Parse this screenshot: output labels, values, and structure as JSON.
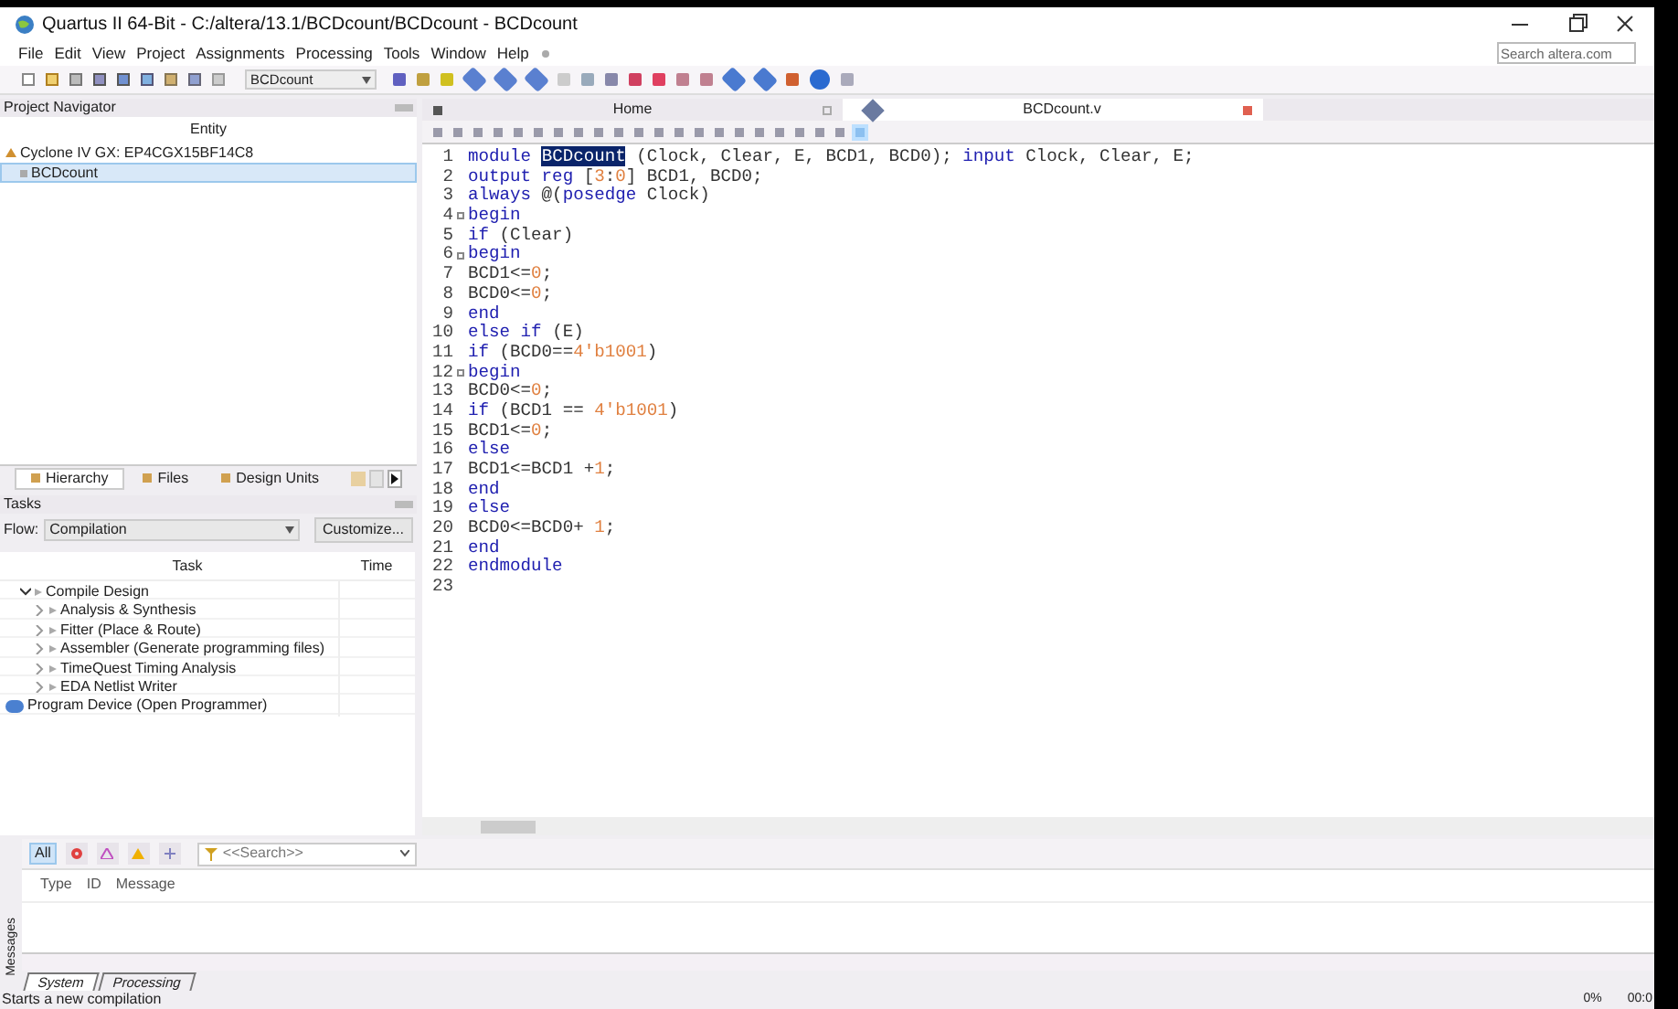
{
  "window": {
    "title": "Quartus II 64-Bit - C:/altera/13.1/BCDcount/BCDcount - BCDcount",
    "search_placeholder": "Search altera.com"
  },
  "menu": [
    "File",
    "Edit",
    "View",
    "Project",
    "Assignments",
    "Processing",
    "Tools",
    "Window",
    "Help"
  ],
  "toolbar": {
    "entity": "BCDcount"
  },
  "project_navigator": {
    "title": "Project Navigator",
    "column": "Entity",
    "tree": [
      {
        "label": "Cyclone IV GX: EP4CGX15BF14C8",
        "selected": false,
        "children": [
          {
            "label": "BCDcount",
            "selected": true
          }
        ]
      }
    ],
    "tabs": [
      {
        "label": "Hierarchy",
        "selected": true
      },
      {
        "label": "Files",
        "selected": false
      },
      {
        "label": "Design Units",
        "selected": false
      }
    ]
  },
  "tasks": {
    "title": "Tasks",
    "flow_label": "Flow:",
    "flow": "Compilation",
    "customize": "Customize...",
    "columns": [
      "Task",
      "Time"
    ],
    "items": [
      {
        "label": "Compile Design",
        "kind": "flow",
        "expanded": true,
        "children": [
          {
            "label": "Analysis & Synthesis",
            "kind": "flow",
            "expanded": false
          },
          {
            "label": "Fitter (Place & Route)",
            "kind": "flow",
            "expanded": false
          },
          {
            "label": "Assembler (Generate programming files)",
            "kind": "flow",
            "expanded": false
          },
          {
            "label": "TimeQuest Timing Analysis",
            "kind": "flow",
            "expanded": false
          },
          {
            "label": "EDA Netlist Writer",
            "kind": "flow",
            "expanded": false
          }
        ]
      },
      {
        "label": "Program Device (Open Programmer)",
        "kind": "tool"
      }
    ]
  },
  "editor": {
    "tabs": [
      {
        "label": "Home",
        "selected": false
      },
      {
        "label": "BCDcount.v",
        "selected": true
      }
    ],
    "lines": [
      {
        "number": "1",
        "fold": false,
        "tokens": [
          {
            "kind": "kw",
            "text": "module "
          },
          {
            "kind": "hl",
            "text": "BCDcount"
          },
          {
            "kind": "text",
            "text": " (Clock, Clear, E, BCD1, BCD0); "
          },
          {
            "kind": "kw",
            "text": "input"
          },
          {
            "kind": "text",
            "text": " Clock, Clear, E;"
          }
        ]
      },
      {
        "number": "2",
        "fold": false,
        "tokens": [
          {
            "kind": "kw",
            "text": "output reg "
          },
          {
            "kind": "text",
            "text": "["
          },
          {
            "kind": "num",
            "text": "3"
          },
          {
            "kind": "text",
            "text": ":"
          },
          {
            "kind": "num",
            "text": "0"
          },
          {
            "kind": "text",
            "text": "] BCD1, BCD0;"
          }
        ]
      },
      {
        "number": "3",
        "fold": false,
        "tokens": [
          {
            "kind": "kw",
            "text": "always"
          },
          {
            "kind": "text",
            "text": " @("
          },
          {
            "kind": "kw",
            "text": "posedge"
          },
          {
            "kind": "text",
            "text": " Clock)"
          }
        ]
      },
      {
        "number": "4",
        "fold": true,
        "tokens": [
          {
            "kind": "kw",
            "text": "begin"
          }
        ]
      },
      {
        "number": "5",
        "fold": false,
        "tokens": [
          {
            "kind": "kw",
            "text": "if"
          },
          {
            "kind": "text",
            "text": " (Clear)"
          }
        ]
      },
      {
        "number": "6",
        "fold": true,
        "tokens": [
          {
            "kind": "kw",
            "text": "begin"
          }
        ]
      },
      {
        "number": "7",
        "fold": false,
        "tokens": [
          {
            "kind": "text",
            "text": "BCD1<="
          },
          {
            "kind": "num",
            "text": "0"
          },
          {
            "kind": "text",
            "text": ";"
          }
        ]
      },
      {
        "number": "8",
        "fold": false,
        "tokens": [
          {
            "kind": "text",
            "text": "BCD0<="
          },
          {
            "kind": "num",
            "text": "0"
          },
          {
            "kind": "text",
            "text": ";"
          }
        ]
      },
      {
        "number": "9",
        "fold": false,
        "tokens": [
          {
            "kind": "kw",
            "text": "end"
          }
        ]
      },
      {
        "number": "10",
        "fold": false,
        "tokens": [
          {
            "kind": "kw",
            "text": "else if"
          },
          {
            "kind": "text",
            "text": " (E)"
          }
        ]
      },
      {
        "number": "11",
        "fold": false,
        "tokens": [
          {
            "kind": "kw",
            "text": "if"
          },
          {
            "kind": "text",
            "text": " (BCD0=="
          },
          {
            "kind": "num",
            "text": "4'b1001"
          },
          {
            "kind": "text",
            "text": ")"
          }
        ]
      },
      {
        "number": "12",
        "fold": true,
        "tokens": [
          {
            "kind": "kw",
            "text": "begin"
          }
        ]
      },
      {
        "number": "13",
        "fold": false,
        "tokens": [
          {
            "kind": "text",
            "text": "BCD0<="
          },
          {
            "kind": "num",
            "text": "0"
          },
          {
            "kind": "text",
            "text": ";"
          }
        ]
      },
      {
        "number": "14",
        "fold": false,
        "tokens": [
          {
            "kind": "kw",
            "text": "if"
          },
          {
            "kind": "text",
            "text": " (BCD1 == "
          },
          {
            "kind": "num",
            "text": "4'b1001"
          },
          {
            "kind": "text",
            "text": ")"
          }
        ]
      },
      {
        "number": "15",
        "fold": false,
        "tokens": [
          {
            "kind": "text",
            "text": "BCD1<="
          },
          {
            "kind": "num",
            "text": "0"
          },
          {
            "kind": "text",
            "text": ";"
          }
        ]
      },
      {
        "number": "16",
        "fold": false,
        "tokens": [
          {
            "kind": "kw",
            "text": "else"
          }
        ]
      },
      {
        "number": "17",
        "fold": false,
        "tokens": [
          {
            "kind": "text",
            "text": "BCD1<=BCD1 +"
          },
          {
            "kind": "num",
            "text": "1"
          },
          {
            "kind": "text",
            "text": ";"
          }
        ]
      },
      {
        "number": "18",
        "fold": false,
        "tokens": [
          {
            "kind": "kw",
            "text": "end"
          }
        ]
      },
      {
        "number": "19",
        "fold": false,
        "tokens": [
          {
            "kind": "kw",
            "text": "else"
          }
        ]
      },
      {
        "number": "20",
        "fold": false,
        "tokens": [
          {
            "kind": "text",
            "text": "BCD0<=BCD0+ "
          },
          {
            "kind": "num",
            "text": "1"
          },
          {
            "kind": "text",
            "text": ";"
          }
        ]
      },
      {
        "number": "21",
        "fold": false,
        "tokens": [
          {
            "kind": "kw",
            "text": "end"
          }
        ]
      },
      {
        "number": "22",
        "fold": false,
        "tokens": [
          {
            "kind": "kw",
            "text": "endmodule"
          }
        ]
      },
      {
        "number": "23",
        "fold": false
      }
    ]
  },
  "messages": {
    "side_label": "Messages",
    "filters": [
      {
        "label": "All",
        "selected": true
      }
    ],
    "search_placeholder": "<<Search>>",
    "columns": [
      "Type",
      "ID",
      "Message"
    ],
    "tabs": [
      {
        "label": "System",
        "selected": true
      },
      {
        "label": "Processing",
        "selected": false
      }
    ]
  },
  "status_bar": {
    "text": "Starts a new compilation",
    "progress": "0%",
    "time": "00:0"
  }
}
